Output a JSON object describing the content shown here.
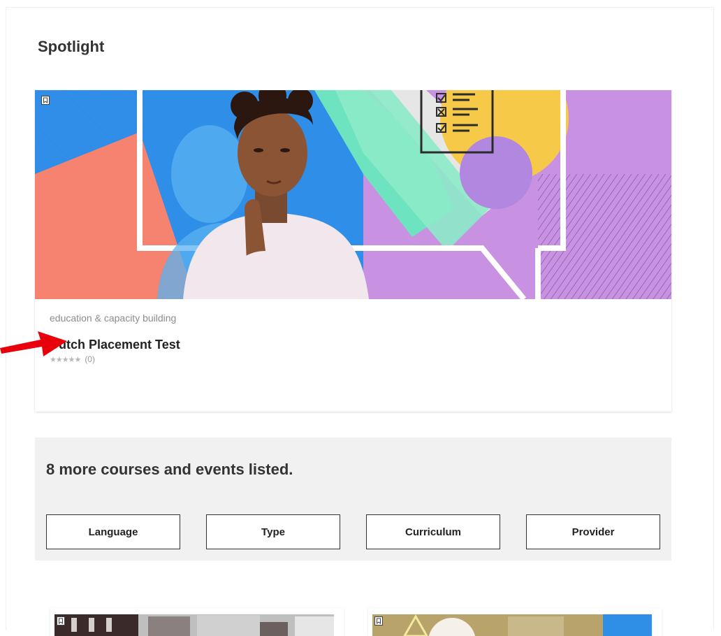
{
  "spotlight": {
    "heading": "Spotlight",
    "card": {
      "category": "education & capacity building",
      "title": "Dutch Placement Test",
      "rating_stars": "★★★★★",
      "rating_count": "(0)",
      "bookmark_icon": "bookmark-icon"
    }
  },
  "more": {
    "text": "8 more courses and events listed.",
    "filters": [
      {
        "label": "Language"
      },
      {
        "label": "Type"
      },
      {
        "label": "Curriculum"
      },
      {
        "label": "Provider"
      }
    ]
  },
  "annotation": {
    "arrow_color": "#e8000b"
  },
  "colors": {
    "panel_bg": "#f1f1f1",
    "category_text": "#8c8c8c"
  }
}
